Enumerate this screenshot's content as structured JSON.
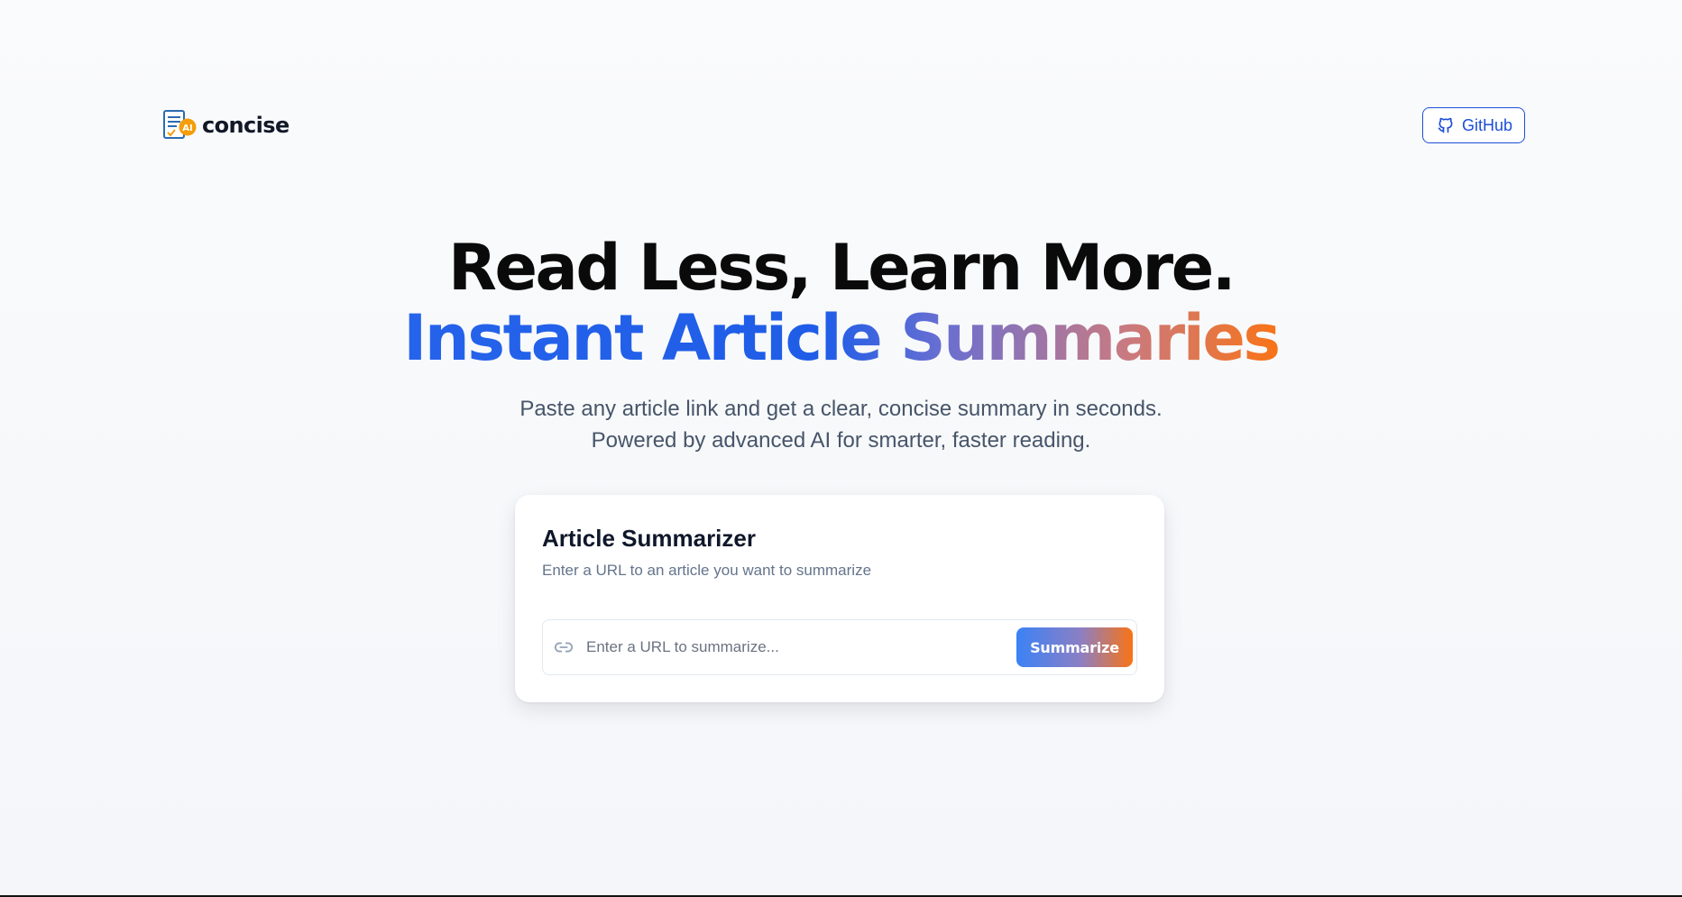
{
  "header": {
    "logo_text": "concise",
    "logo_badge": "AI",
    "github_label": "GitHub"
  },
  "hero": {
    "headline_line1": "Read Less, Learn More.",
    "headline_line2": "Instant Article Summaries",
    "subtitle_line1": "Paste any article link and get a clear, concise summary in seconds.",
    "subtitle_line2": "Powered by advanced AI for smarter, faster reading."
  },
  "card": {
    "title": "Article Summarizer",
    "description": "Enter a URL to an article you want to summarize",
    "input_placeholder": "Enter a URL to summarize...",
    "input_value": "",
    "button_label": "Summarize"
  },
  "colors": {
    "accent_blue": "#2563eb",
    "accent_orange": "#f97316",
    "github_border": "#1d4ed8"
  },
  "icons": {
    "logo": "document-ai-icon",
    "github": "github-icon",
    "link": "link-icon"
  }
}
